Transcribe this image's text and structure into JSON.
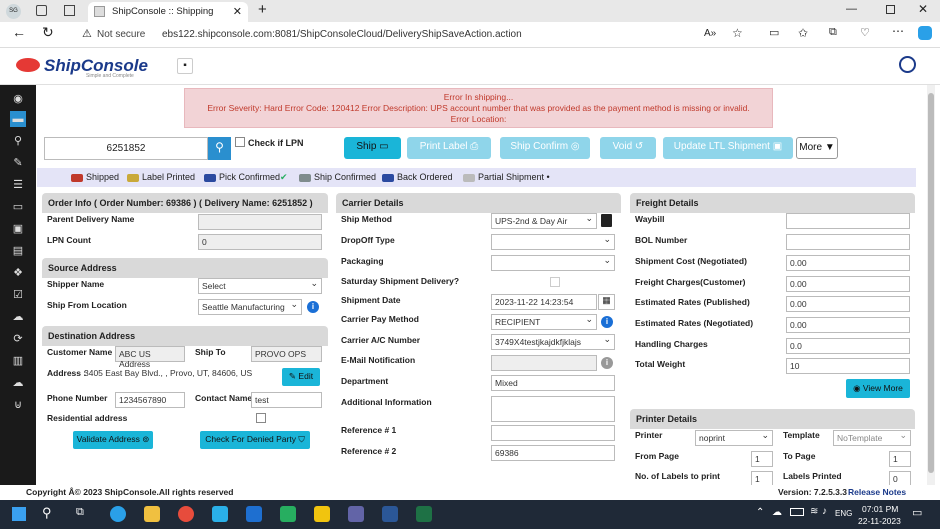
{
  "browser": {
    "profile": "SG",
    "tab_title": "ShipConsole :: Shipping",
    "security": "Not secure",
    "url": "ebs122.shipconsole.com:8081/ShipConsoleCloud/DeliveryShipSaveAction.action"
  },
  "app": {
    "logo": "ShipConsole",
    "logo_tagline": "Simple and Complete"
  },
  "error": {
    "line1": "Error In shipping...",
    "line2": "Error Severity: Hard Error Code: 120412 Error Description: UPS account number that was provided as the payment method is missing or invalid.",
    "line3": "Error Location:"
  },
  "toolbar": {
    "order_number": "6251852",
    "check_lpn": "Check if LPN",
    "ship": "Ship",
    "print_label": "Print Label",
    "ship_confirm": "Ship Confirm",
    "void": "Void",
    "update_ltl": "Update LTL Shipment",
    "more": "More"
  },
  "legend": {
    "shipped": "Shipped",
    "label_printed": "Label Printed",
    "pick_confirmed": "Pick Confirmed",
    "ship_confirmed": "Ship Confirmed",
    "back_ordered": "Back Ordered",
    "partial": "Partial Shipment"
  },
  "order_info": {
    "header": "Order Info ( Order Number: 69386 ) ( Delivery Name: 6251852 )",
    "parent_delivery_label": "Parent Delivery Name",
    "parent_delivery_value": "",
    "lpn_count_label": "LPN Count",
    "lpn_count_value": "0"
  },
  "source": {
    "header": "Source Address",
    "shipper_label": "Shipper Name",
    "shipper_value": "Select",
    "ship_from_label": "Ship From Location",
    "ship_from_value": "Seattle Manufacturing"
  },
  "destination": {
    "header": "Destination Address",
    "customer_label": "Customer Name",
    "customer_value": "ABC US Address",
    "ship_to_label": "Ship To",
    "ship_to_value": "PROVO OPS",
    "address_label": "Address :",
    "address_value": "3405 East Bay Blvd., , Provo, UT, 84606, US",
    "edit": "Edit",
    "phone_label": "Phone Number",
    "phone_value": "1234567890",
    "contact_label": "Contact Name",
    "contact_value": "test",
    "residential_label": "Residential address",
    "validate": "Validate Address",
    "denied": "Check For Denied Party"
  },
  "carrier": {
    "header": "Carrier Details",
    "ship_method_label": "Ship Method",
    "ship_method_value": "UPS-2nd & Day Air",
    "dropoff_label": "DropOff Type",
    "packaging_label": "Packaging",
    "saturday_label": "Saturday Shipment Delivery?",
    "ship_date_label": "Shipment Date",
    "ship_date_value": "2023-11-22 14:23:54",
    "pay_method_label": "Carrier Pay Method",
    "pay_method_value": "RECIPIENT",
    "account_label": "Carrier A/C Number",
    "account_value": "3749X4testjkajdkfjklajs",
    "email_label": "E-Mail Notification",
    "department_label": "Department",
    "department_value": "Mixed",
    "additional_label": "Additional Information",
    "ref1_label": "Reference # 1",
    "ref1_value": "",
    "ref2_label": "Reference # 2",
    "ref2_value": "69386"
  },
  "freight": {
    "header": "Freight Details",
    "waybill_label": "Waybill",
    "bol_label": "BOL Number",
    "ship_cost_label": "Shipment Cost (Negotiated)",
    "ship_cost_value": "0.00",
    "freight_charges_label": "Freight Charges(Customer)",
    "freight_charges_value": "0.00",
    "est_pub_label": "Estimated Rates (Published)",
    "est_pub_value": "0.00",
    "est_neg_label": "Estimated Rates (Negotiated)",
    "est_neg_value": "0.00",
    "handling_label": "Handling Charges",
    "handling_value": "0.0",
    "weight_label": "Total Weight",
    "weight_value": "10",
    "view_more": "View More"
  },
  "printer": {
    "header": "Printer Details",
    "printer_label": "Printer",
    "printer_value": "noprint",
    "template_label": "Template",
    "template_value": "NoTemplate",
    "from_page_label": "From Page",
    "from_page_value": "1",
    "to_page_label": "To Page",
    "to_page_value": "1",
    "labels_label": "No. of Labels to print",
    "labels_value": "1",
    "printed_label": "Labels Printed",
    "printed_value": "0"
  },
  "footer": {
    "copyright": "Copyright Â© 2023 ShipConsole.All rights reserved",
    "version": "Version:  7.2.5.3.3",
    "release_notes": "Release Notes"
  },
  "taskbar": {
    "time": "07:01 PM",
    "date": "22-11-2023",
    "lang": "ENG"
  }
}
